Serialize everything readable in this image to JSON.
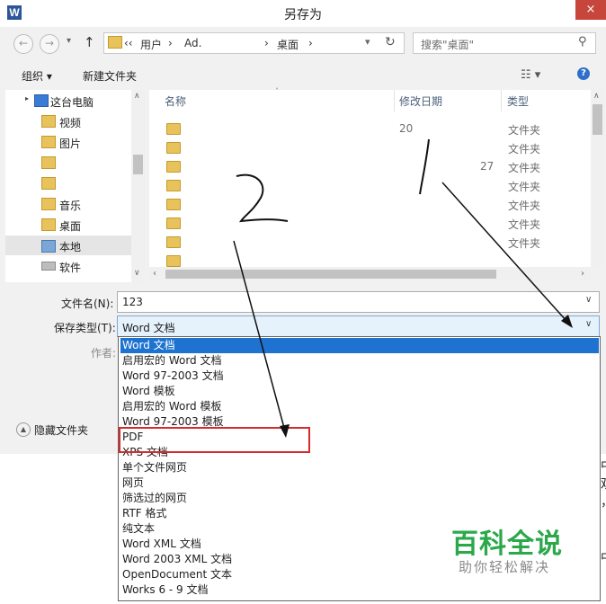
{
  "window": {
    "title": "另存为",
    "app_icon": "W",
    "close": "×"
  },
  "address_bar": {
    "crumbs": [
      "‹‹",
      "用户",
      "›",
      "Ad.",
      "›",
      "桌面",
      "›"
    ],
    "search_placeholder": "搜索\"桌面\""
  },
  "toolbar": {
    "organize": "组织 ▾",
    "new_folder": "新建文件夹"
  },
  "nav_pane": {
    "items": [
      {
        "label": "这台电脑"
      },
      {
        "label": "视频"
      },
      {
        "label": "图片"
      },
      {
        "label": ""
      },
      {
        "label": ""
      },
      {
        "label": "音乐"
      },
      {
        "label": "桌面"
      },
      {
        "label": "本地"
      },
      {
        "label": "软件"
      }
    ]
  },
  "file_list": {
    "columns": {
      "name": "名称",
      "date": "修改日期",
      "type": "类型"
    },
    "rows": [
      {
        "date": "20",
        "type": "文件夹"
      },
      {
        "date": "",
        "type": "文件夹"
      },
      {
        "date": "27",
        "type": "文件夹"
      },
      {
        "date": "",
        "type": "文件夹"
      },
      {
        "date": "",
        "type": "文件夹"
      },
      {
        "date": "",
        "type": "文件夹"
      },
      {
        "date": "",
        "type": "文件夹"
      }
    ]
  },
  "form": {
    "filename_label": "文件名(N):",
    "filename_value": "123",
    "type_label": "保存类型(T):",
    "type_value": "Word 文档",
    "author_label": "作者:"
  },
  "hide_folders": "隐藏文件夹",
  "type_options": [
    "Word 文档",
    "启用宏的 Word 文档",
    "Word 97-2003 文档",
    "Word 模板",
    "启用宏的 Word 模板",
    "Word 97-2003 模板",
    "PDF",
    "XPS 文档",
    "单个文件网页",
    "网页",
    "筛选过的网页",
    "RTF 格式",
    "纯文本",
    "Word XML 文档",
    "Word 2003 XML 文档",
    "OpenDocument 文本",
    "Works 6 - 9 文档"
  ],
  "annotations": {
    "mark_one": "1",
    "mark_two": "2"
  },
  "watermark": {
    "main": "百科全说",
    "sub": "助你轻松解决"
  },
  "colors": {
    "selection": "#1e73d0",
    "highlight_box": "#d52b2b",
    "watermark": "#2aa84a",
    "close": "#c7463b"
  }
}
